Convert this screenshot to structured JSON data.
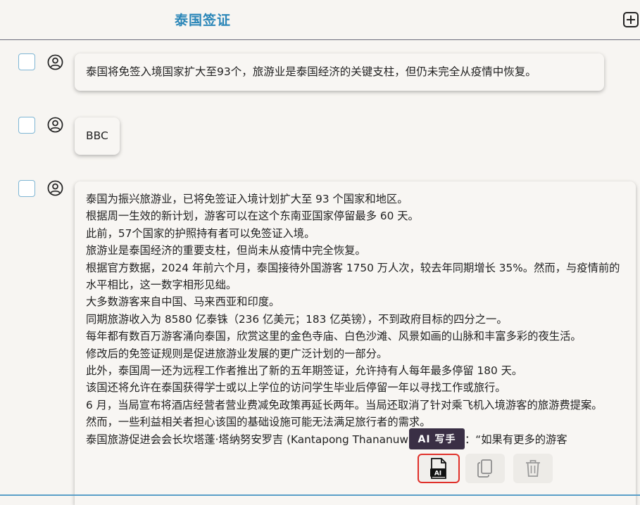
{
  "header": {
    "title": "泰国签证"
  },
  "messages": [
    {
      "text": "泰国将免签入境国家扩大至93个，旅游业是泰国经济的关键支柱，但仍未完全从疫情中恢复。"
    },
    {
      "text": "BBC"
    },
    {
      "lines": [
        "泰国为振兴旅游业，已将免签证入境计划扩大至 93 个国家和地区。",
        "根据周一生效的新计划，游客可以在这个东南亚国家停留最多 60 天。",
        "此前，57个国家的护照持有者可以免签证入境。",
        "旅游业是泰国经济的重要支柱，但尚未从疫情中完全恢复。",
        "根据官方数据，2024 年前六个月，泰国接待外国游客 1750 万人次，较去年同期增长 35%。然而，与疫情前的水平相比，这一数字相形见绌。",
        "大多数游客来自中国、马来西亚和印度。",
        "同期旅游收入为 8580 亿泰铢（236 亿美元；183 亿英镑），不到政府目标的四分之一。",
        "每年都有数百万游客涌向泰国，欣赏这里的金色寺庙、白色沙滩、风景如画的山脉和丰富多彩的夜生活。",
        "修改后的免签证规则是促进旅游业发展的更广泛计划的一部分。",
        "此外，泰国周一还为远程工作者推出了新的五年期签证，允许持有人每年最多停留 180 天。",
        "该国还将允许在泰国获得学士或以上学位的访问学生毕业后停留一年以寻找工作或旅行。",
        "6 月，当局宣布将酒店经营者营业费减免政策再延长两年。当局还取消了针对乘飞机入境游客的旅游费提案。",
        "然而，一些利益相关者担心该国的基础设施可能无法满足旅行者的需求。",
        "泰国旅游促进会会长坎塔蓬·塔纳努安罗吉 (Kantapong Thananuwanroj) 表示：“如果有更多的游客"
      ]
    }
  ],
  "toolbar": {
    "tooltip": "AI 写手",
    "ai_icon_label": "AI"
  },
  "colors": {
    "title": "#2a86b8",
    "checkbox_border": "#7fb6d4",
    "tooltip_bg": "#3a2f45",
    "highlight": "#e0302a"
  }
}
